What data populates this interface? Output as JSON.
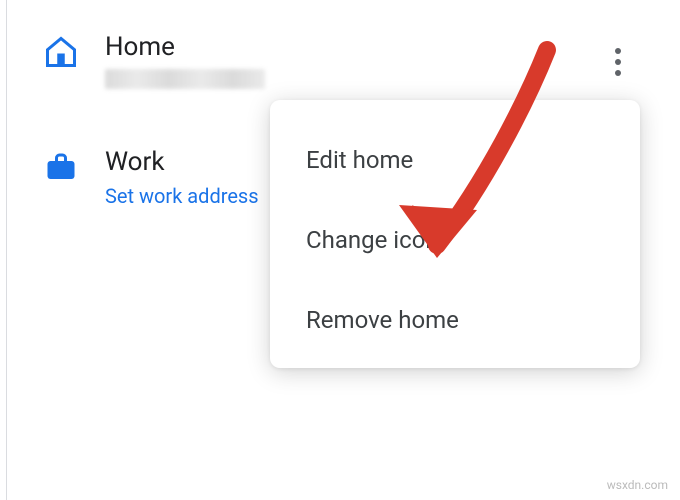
{
  "attribution": "wsxdn.com",
  "shortcuts": [
    {
      "title": "Home",
      "subtitle": "",
      "link_text": "",
      "icon": "home"
    },
    {
      "title": "Work",
      "subtitle": "",
      "link_text": "Set work address",
      "icon": "work"
    }
  ],
  "menu": {
    "items": [
      {
        "label": "Edit home"
      },
      {
        "label": "Change icon"
      },
      {
        "label": "Remove home"
      }
    ]
  },
  "colors": {
    "accent": "#1a73e8",
    "arrow": "#d83a2b"
  }
}
